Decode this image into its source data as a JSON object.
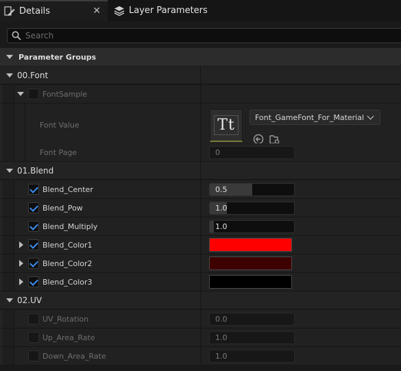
{
  "tabs": [
    {
      "label": "Details",
      "icon": "details-pencil-icon",
      "active": true
    },
    {
      "label": "Layer Parameters",
      "icon": "layers-icon",
      "active": false
    }
  ],
  "search": {
    "placeholder": "Search"
  },
  "parameter_groups_label": "Parameter Groups",
  "groups": {
    "font": {
      "label": "00.Font",
      "font_sample": {
        "label": "FontSample",
        "enabled": false
      },
      "font_value": {
        "label": "Font Value",
        "asset": "Font_GameFont_For_Material",
        "thumb_text": "Tt"
      },
      "font_page": {
        "label": "Font Page",
        "value": "0"
      }
    },
    "blend": {
      "label": "01.Blend",
      "center": {
        "label": "Blend_Center",
        "value": "0.5",
        "enabled": true,
        "fill_fraction": 0.5
      },
      "pow": {
        "label": "Blend_Pow",
        "value": "1.0",
        "enabled": true,
        "fill_fraction": 0.2
      },
      "multiply": {
        "label": "Blend_Multiply",
        "value": "1.0",
        "enabled": true,
        "fill_fraction": 0.05
      },
      "color1": {
        "label": "Blend_Color1",
        "color": "#ff0000",
        "enabled": true
      },
      "color2": {
        "label": "Blend_Color2",
        "color": "#3f0000",
        "enabled": true
      },
      "color3": {
        "label": "Blend_Color3",
        "color": "#000000",
        "enabled": true
      }
    },
    "uv": {
      "label": "02.UV",
      "rotation": {
        "label": "UV_Rotation",
        "value": "0.0",
        "enabled": false
      },
      "up_area": {
        "label": "Up_Area_Rate",
        "value": "1.0",
        "enabled": false
      },
      "down_area": {
        "label": "Down_Area_Rate",
        "value": "1.0",
        "enabled": false
      }
    }
  },
  "colors": {
    "accent_check": "#3b8ef2"
  }
}
